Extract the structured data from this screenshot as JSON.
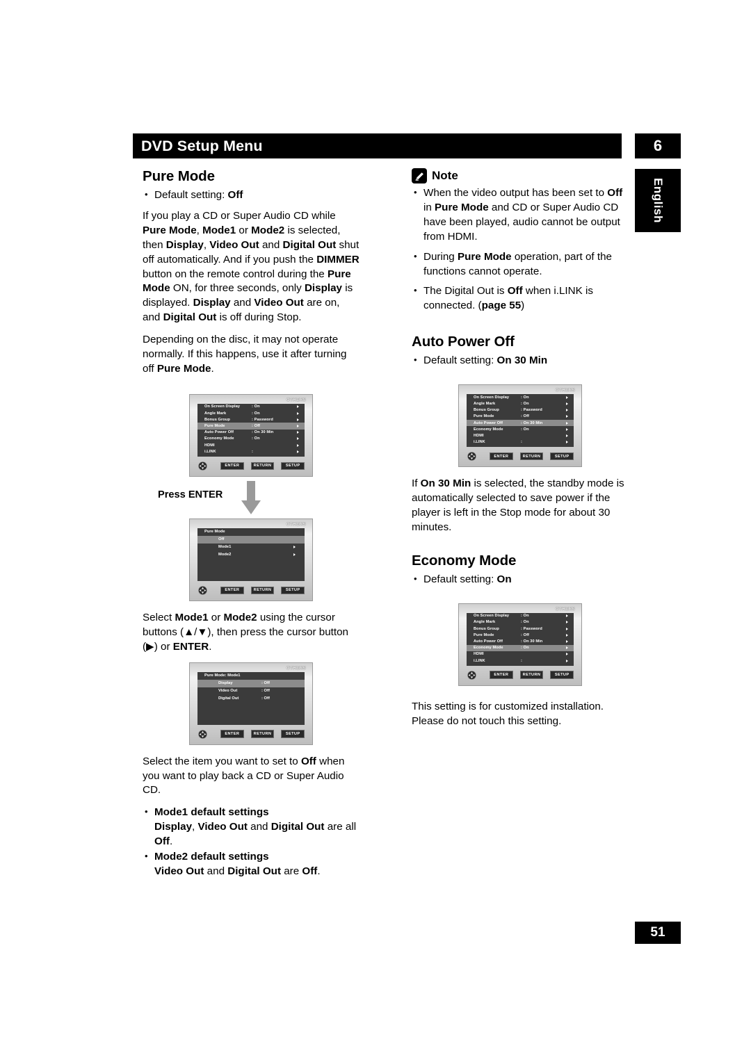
{
  "header": {
    "title": "DVD Setup Menu",
    "chapter": "6",
    "language_tab": "English",
    "page_number": "51"
  },
  "left_column": {
    "section_title": "Pure Mode",
    "default_setting_label": "Default setting: ",
    "default_setting_value": "Off",
    "paragraph1": {
      "parts": [
        {
          "t": "If you play a CD or Super Audio CD while ",
          "b": false
        },
        {
          "t": "Pure Mode",
          "b": true
        },
        {
          "t": ", ",
          "b": false
        },
        {
          "t": "Mode1",
          "b": true
        },
        {
          "t": " or ",
          "b": false
        },
        {
          "t": "Mode2",
          "b": true
        },
        {
          "t": " is selected, then ",
          "b": false
        },
        {
          "t": "Display",
          "b": true
        },
        {
          "t": ", ",
          "b": false
        },
        {
          "t": "Video Out",
          "b": true
        },
        {
          "t": " and ",
          "b": false
        },
        {
          "t": "Digital Out",
          "b": true
        },
        {
          "t": " shut off automatically. And if you push the ",
          "b": false
        },
        {
          "t": "DIMMER",
          "b": true
        },
        {
          "t": " button on the remote control during the ",
          "b": false
        },
        {
          "t": "Pure Mode",
          "b": true
        },
        {
          "t": " ON, for three seconds, only ",
          "b": false
        },
        {
          "t": "Display",
          "b": true
        },
        {
          "t": " is displayed. ",
          "b": false
        },
        {
          "t": "Display",
          "b": true
        },
        {
          "t": " and ",
          "b": false
        },
        {
          "t": "Video Out",
          "b": true
        },
        {
          "t": " are on, and ",
          "b": false
        },
        {
          "t": "Digital Out",
          "b": true
        },
        {
          "t": " is off during Stop.",
          "b": false
        }
      ]
    },
    "paragraph2": {
      "parts": [
        {
          "t": "Depending on the disc, it may not operate normally. If this happens, use it after turning off ",
          "b": false
        },
        {
          "t": "Pure Mode",
          "b": true
        },
        {
          "t": ".",
          "b": false
        }
      ]
    },
    "press_enter": "Press ENTER",
    "paragraph3": {
      "parts": [
        {
          "t": "Select ",
          "b": false
        },
        {
          "t": "Mode1",
          "b": true
        },
        {
          "t": " or ",
          "b": false
        },
        {
          "t": "Mode2",
          "b": true
        },
        {
          "t": " using the cursor buttons (▲/▼), then press the cursor button (▶) or ",
          "b": false
        },
        {
          "t": "ENTER",
          "b": true
        },
        {
          "t": ".",
          "b": false
        }
      ]
    },
    "paragraph4": {
      "parts": [
        {
          "t": "Select the item you want to set to ",
          "b": false
        },
        {
          "t": "Off",
          "b": true
        },
        {
          "t": " when you want to play back a CD or Super Audio CD.",
          "b": false
        }
      ]
    },
    "mode_defaults": [
      {
        "heading": "Mode1 default settings",
        "detail": [
          {
            "t": "Display",
            "b": true
          },
          {
            "t": ", ",
            "b": false
          },
          {
            "t": "Video Out",
            "b": true
          },
          {
            "t": " and ",
            "b": false
          },
          {
            "t": "Digital Out",
            "b": true
          },
          {
            "t": " are all ",
            "b": false
          },
          {
            "t": "Off",
            "b": true
          },
          {
            "t": ".",
            "b": false
          }
        ]
      },
      {
        "heading": "Mode2 default settings",
        "detail": [
          {
            "t": "Video Out",
            "b": true
          },
          {
            "t": " and ",
            "b": false
          },
          {
            "t": "Digital Out",
            "b": true
          },
          {
            "t": " are ",
            "b": false
          },
          {
            "t": "Off",
            "b": true
          },
          {
            "t": ".",
            "b": false
          }
        ]
      }
    ]
  },
  "right_column": {
    "note": {
      "label": "Note",
      "icon": "pencil-icon",
      "items": [
        [
          {
            "t": "When the video output has been set to ",
            "b": false
          },
          {
            "t": "Off",
            "b": true
          },
          {
            "t": " in ",
            "b": false
          },
          {
            "t": "Pure Mode",
            "b": true
          },
          {
            "t": " and CD or Super Audio CD have been played, audio cannot be output from HDMI.",
            "b": false
          }
        ],
        [
          {
            "t": "During ",
            "b": false
          },
          {
            "t": "Pure Mode",
            "b": true
          },
          {
            "t": " operation, part of the functions cannot operate.",
            "b": false
          }
        ],
        [
          {
            "t": "The Digital Out is ",
            "b": false
          },
          {
            "t": "Off",
            "b": true
          },
          {
            "t": " when i.LINK is connected. (",
            "b": false
          },
          {
            "t": "page 55",
            "b": true
          },
          {
            "t": ")",
            "b": false
          }
        ]
      ]
    },
    "auto_power_off": {
      "title": "Auto Power Off",
      "default_setting_label": "Default setting: ",
      "default_setting_value": "On 30 Min",
      "paragraph": [
        {
          "t": "If ",
          "b": false
        },
        {
          "t": "On 30 Min",
          "b": true
        },
        {
          "t": " is selected, the standby mode is automatically selected to save power if the player is left in the Stop mode for about 30 minutes.",
          "b": false
        }
      ]
    },
    "economy_mode": {
      "title": "Economy Mode",
      "default_setting_label": "Default setting: ",
      "default_setting_value": "On",
      "paragraph": [
        {
          "t": "This setting is for customized installation. Please do not touch this setting.",
          "b": false
        }
      ]
    }
  },
  "osd_screens": {
    "others_label": "OTHERS",
    "buttons": {
      "enter": "ENTER",
      "return": "RETURN",
      "setup": "SETUP"
    },
    "others_menu_rows": [
      {
        "label": "On Screen Display",
        "value": ": On"
      },
      {
        "label": "Angle Mark",
        "value": ": On"
      },
      {
        "label": "Bonus Group",
        "value": ": Password"
      },
      {
        "label": "Pure Mode",
        "value": ": Off"
      },
      {
        "label": "Auto Power Off",
        "value": ": On 30 Min"
      },
      {
        "label": "Economy Mode",
        "value": ": On"
      },
      {
        "label": "HDMI",
        "value": ""
      },
      {
        "label": "i.LINK",
        "value": ":"
      }
    ],
    "screen1_highlight_index": 3,
    "screen_auto_power_highlight_index": 4,
    "screen_economy_highlight_index": 5,
    "pure_mode_menu": {
      "title": "Pure Mode",
      "items": [
        {
          "label": "Off",
          "highlight": true,
          "arrow": false
        },
        {
          "label": "Mode1",
          "highlight": false,
          "arrow": true
        },
        {
          "label": "Mode2",
          "highlight": false,
          "arrow": true
        }
      ]
    },
    "mode1_menu": {
      "title": "Pure Mode: Mode1",
      "rows": [
        {
          "label": "Display",
          "value": ": Off",
          "highlight": true
        },
        {
          "label": "Video Out",
          "value": ": Off",
          "highlight": false
        },
        {
          "label": "Digital Out",
          "value": ": Off",
          "highlight": false
        }
      ]
    }
  }
}
